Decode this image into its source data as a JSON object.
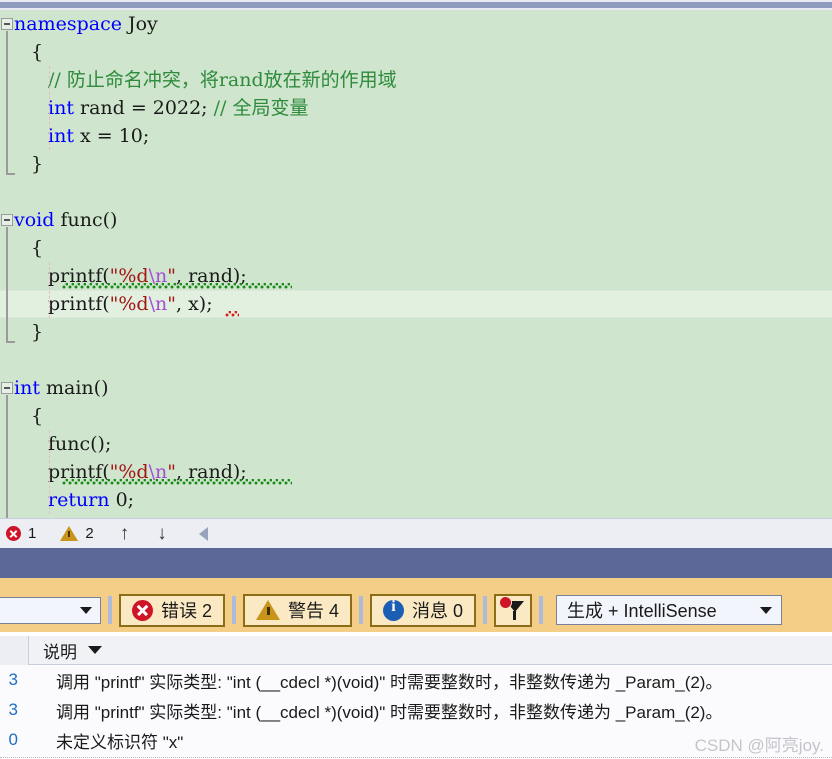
{
  "editor": {
    "background_color": "#cfe5cd",
    "lines": [
      {
        "indent": 0,
        "fold": true,
        "tokens": [
          {
            "t": "namespace ",
            "c": "kw"
          },
          {
            "t": "Joy",
            "c": "id"
          }
        ]
      },
      {
        "indent": 1,
        "tokens": [
          {
            "t": "{",
            "c": "id"
          }
        ]
      },
      {
        "indent": 2,
        "tokens": [
          {
            "t": "// 防止命名冲突，将rand放在新的作用域",
            "c": "cmt"
          }
        ]
      },
      {
        "indent": 2,
        "tokens": [
          {
            "t": "int",
            "c": "kw"
          },
          {
            "t": " rand = 2022; ",
            "c": "id"
          },
          {
            "t": "// 全局变量",
            "c": "cmt"
          }
        ]
      },
      {
        "indent": 2,
        "tokens": [
          {
            "t": "int",
            "c": "kw"
          },
          {
            "t": " x = 10;",
            "c": "id"
          }
        ]
      },
      {
        "indent": 1,
        "tokens": [
          {
            "t": "}",
            "c": "id"
          }
        ]
      },
      {
        "indent": 0,
        "tokens": []
      },
      {
        "indent": 0,
        "fold": true,
        "tokens": [
          {
            "t": "void",
            "c": "kw"
          },
          {
            "t": " func()",
            "c": "id"
          }
        ]
      },
      {
        "indent": 1,
        "tokens": [
          {
            "t": "{",
            "c": "id"
          }
        ]
      },
      {
        "indent": 2,
        "tokens": [
          {
            "t": "printf(",
            "c": "id"
          },
          {
            "t": "\"%d",
            "c": "str"
          },
          {
            "t": "\\n",
            "c": "esc"
          },
          {
            "t": "\"",
            "c": "str"
          },
          {
            "t": ", rand);",
            "c": "id"
          }
        ]
      },
      {
        "indent": 2,
        "tokens": [
          {
            "t": "printf(",
            "c": "id"
          },
          {
            "t": "\"%d",
            "c": "str"
          },
          {
            "t": "\\n",
            "c": "esc"
          },
          {
            "t": "\"",
            "c": "str"
          },
          {
            "t": ", x);",
            "c": "id"
          }
        ]
      },
      {
        "indent": 1,
        "tokens": [
          {
            "t": "}",
            "c": "id"
          }
        ]
      },
      {
        "indent": 0,
        "tokens": []
      },
      {
        "indent": 0,
        "fold": true,
        "tokens": [
          {
            "t": "int",
            "c": "kw"
          },
          {
            "t": " main()",
            "c": "id"
          }
        ]
      },
      {
        "indent": 1,
        "tokens": [
          {
            "t": "{",
            "c": "id"
          }
        ]
      },
      {
        "indent": 2,
        "tokens": [
          {
            "t": "func();",
            "c": "id"
          }
        ]
      },
      {
        "indent": 2,
        "tokens": [
          {
            "t": "printf(",
            "c": "id"
          },
          {
            "t": "\"%d",
            "c": "str"
          },
          {
            "t": "\\n",
            "c": "esc"
          },
          {
            "t": "\"",
            "c": "str"
          },
          {
            "t": ", rand);",
            "c": "id"
          }
        ]
      },
      {
        "indent": 2,
        "tokens": [
          {
            "t": "return",
            "c": "kw"
          },
          {
            "t": " 0;",
            "c": "id"
          }
        ]
      },
      {
        "indent": 1,
        "tokens": [
          {
            "t": "}",
            "c": "id"
          }
        ]
      }
    ]
  },
  "editor_status": {
    "error_count": "1",
    "warning_count": "2",
    "up_arrow": "↑",
    "down_arrow": "↓"
  },
  "error_list_toolbar": {
    "search_value": "",
    "error_label": "错误 2",
    "warning_label": "警告 4",
    "message_label": "消息 0",
    "filter_icon_name": "funnel-icon",
    "scope_value": "生成 + IntelliSense"
  },
  "error_table": {
    "columns": [
      "",
      "说明"
    ],
    "description_header": "说明",
    "rows": [
      {
        "code": "3",
        "description": "调用 \"printf\" 实际类型: \"int (__cdecl *)(void)\" 时需要整数时，非整数传递为 _Param_(2)。"
      },
      {
        "code": "3",
        "description": "调用 \"printf\" 实际类型: \"int (__cdecl *)(void)\" 时需要整数时，非整数传递为 _Param_(2)。"
      },
      {
        "code": "0",
        "description": "未定义标识符 \"x\""
      }
    ]
  },
  "watermark": {
    "text": "CSDN @阿亮joy."
  },
  "colors": {
    "editor_bg": "#cfe5cd",
    "blue_band": "#5b6796",
    "tan_band": "#f4cd87",
    "keyword": "#0000ff",
    "comment": "#2e8b3c",
    "string": "#a31515",
    "escape": "#a64dd6",
    "error_red": "#d01427",
    "warning_gold": "#c8951a",
    "info_blue": "#1a5fb4"
  }
}
